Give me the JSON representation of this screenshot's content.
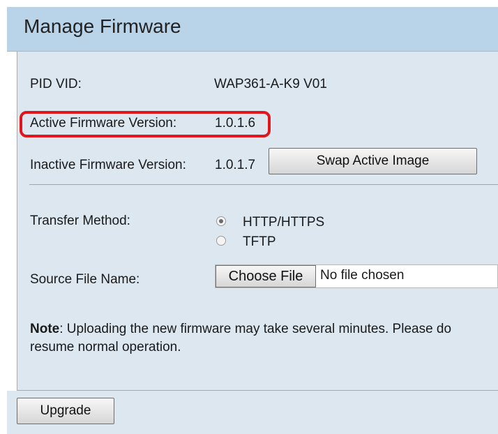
{
  "page": {
    "title": "Manage Firmware"
  },
  "info": {
    "pid_vid_label": "PID VID:",
    "pid_vid_value": "WAP361-A-K9 V01",
    "active_label": "Active Firmware Version:",
    "active_value": "1.0.1.6",
    "inactive_label": "Inactive Firmware Version:",
    "inactive_value": "1.0.1.7",
    "swap_button": "Swap Active Image"
  },
  "transfer": {
    "label": "Transfer Method:",
    "options": [
      {
        "label": "HTTP/HTTPS",
        "selected": true
      },
      {
        "label": "TFTP",
        "selected": false
      }
    ]
  },
  "source": {
    "label": "Source File Name:",
    "choose_button": "Choose File",
    "file_status": "No file chosen"
  },
  "note": {
    "bold": "Note",
    "text": ": Uploading the new firmware may take several minutes. Please do",
    "text2": "resume normal operation."
  },
  "footer": {
    "upgrade_button": "Upgrade"
  },
  "colors": {
    "highlight": "#e0161d",
    "header_bg": "#b9d3e8",
    "panel_bg": "#dce7f0"
  }
}
